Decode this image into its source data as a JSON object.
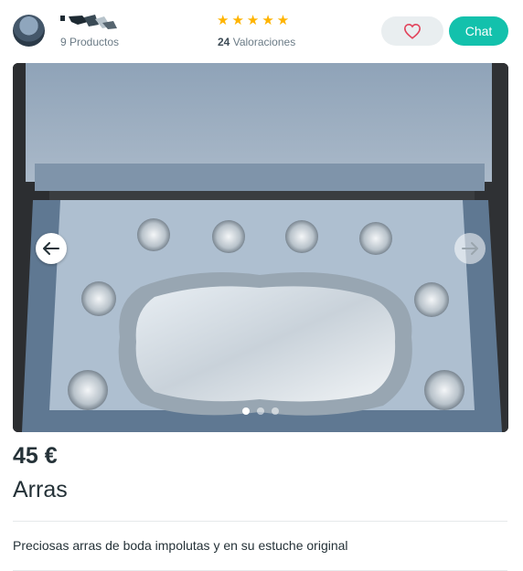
{
  "seller": {
    "products_label": "9 Productos",
    "ratings_count": "24",
    "ratings_label": "Valoraciones",
    "stars": "★★★★★"
  },
  "actions": {
    "chat_label": "Chat"
  },
  "gallery": {
    "current_image": 1,
    "image_count": 3
  },
  "listing": {
    "price": "45 €",
    "title": "Arras",
    "description": "Preciosas arras de boda impolutas y en su estuche original"
  },
  "colors": {
    "accent": "#13c1ac",
    "star": "#ffb400",
    "heart": "#e2445c",
    "text": "#253238"
  }
}
